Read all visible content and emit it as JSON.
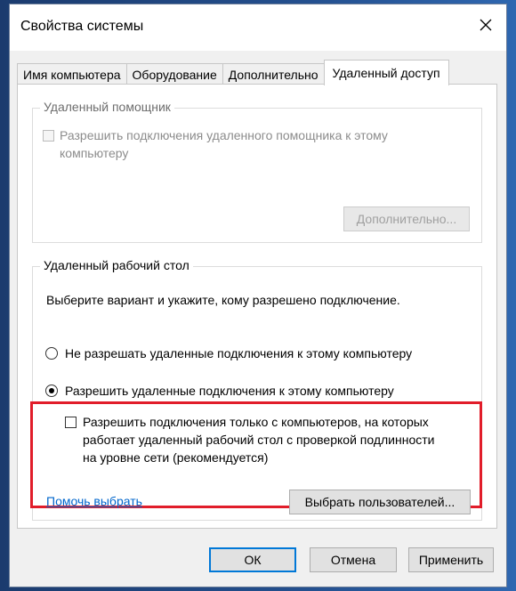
{
  "window": {
    "title": "Свойства системы"
  },
  "tabs": [
    {
      "label": "Имя компьютера",
      "active": false
    },
    {
      "label": "Оборудование",
      "active": false
    },
    {
      "label": "Дополнительно",
      "active": false
    },
    {
      "label": "Удаленный доступ",
      "active": true
    }
  ],
  "remote_assistance": {
    "legend": "Удаленный помощник",
    "checkbox_label_line1": "Разрешить подключения удаленного помощника к этому",
    "checkbox_label_line2": "компьютеру",
    "advanced_button": "Дополнительно..."
  },
  "remote_desktop": {
    "legend": "Удаленный рабочий стол",
    "instruction": "Выберите вариант и укажите, кому разрешено подключение.",
    "option_deny": "Не разрешать удаленные подключения к этому компьютеру",
    "option_allow": "Разрешить удаленные подключения к этому компьютеру",
    "nla_line1": "Разрешить подключения только с компьютеров, на которых",
    "nla_line2": "работает удаленный рабочий стол с проверкой подлинности",
    "nla_line3": "на уровне сети (рекомендуется)",
    "help_link": "Помочь выбрать",
    "select_users_button": "Выбрать пользователей..."
  },
  "footer": {
    "ok": "ОК",
    "cancel": "Отмена",
    "apply": "Применить"
  },
  "colors": {
    "highlight": "#e11d2a",
    "link": "#0066cc",
    "default_button_border": "#0078d7"
  }
}
